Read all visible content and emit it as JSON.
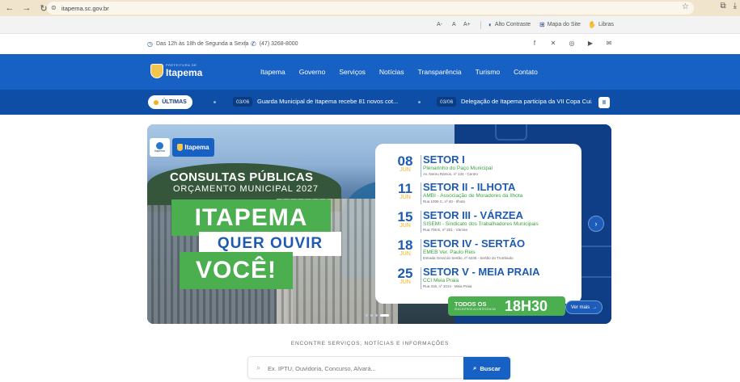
{
  "browser": {
    "url": "itapema.sc.gov.br"
  },
  "access_bar": {
    "font_decrease": "A-",
    "font_reset": "A",
    "font_increase": "A+",
    "high_contrast": "Alto Contraste",
    "site_map": "Mapa do Site",
    "libras": "Libras"
  },
  "info_bar": {
    "hours": "Das 12h às 18h de Segunda a Sexta",
    "phone": "(47) 3268-8000"
  },
  "header": {
    "logo_pre": "PREFEITURA DE",
    "logo_name": "Itapema",
    "menu": [
      "Itapema",
      "Governo",
      "Serviços",
      "Notícias",
      "Transparência",
      "Turismo",
      "Contato"
    ]
  },
  "ticker": {
    "badge": "ÚLTIMAS",
    "items": [
      {
        "date": "03/06",
        "headline": "Guarda Municipal de Itapema recebe 81 novos cot..."
      },
      {
        "date": "03/06",
        "headline": "Delegação de Itapema participa da VII Copa Cui..."
      }
    ],
    "pause": "II"
  },
  "banner": {
    "logo_small_caption": "Itapema",
    "logo_name": "Itapema",
    "consultas": "CONSULTAS PÚBLICAS",
    "orcamento": "ORÇAMENTO MUNICIPAL 2027",
    "headline1": "ITAPEMA",
    "headline2": "QUER OUVIR",
    "headline3": "VOCÊ!",
    "schedule": [
      {
        "day": "08",
        "month": "JUN",
        "sector": "SETOR I",
        "place": "Plenarinho do Paço Municipal",
        "addr": "Av. Nereu Ramos, nº 134 - Centro"
      },
      {
        "day": "11",
        "month": "JUN",
        "sector": "SETOR II - ILHOTA",
        "place": "AMBI - Associação de Moradores da Ilhota",
        "addr": "Rua 1006 C, nº 40 - Ilhota"
      },
      {
        "day": "15",
        "month": "JUN",
        "sector": "SETOR III - VÁRZEA",
        "place": "SISEMI - Sindicato dos Trabalhadores Municipais",
        "addr": "Rua 706 E, nº 201 - Várzea"
      },
      {
        "day": "18",
        "month": "JUN",
        "sector": "SETOR IV - SERTÃO",
        "place": "EMEB Ver. Paulo Reis",
        "addr": "Estrada Geral do Sertão, nº 6236 - Sertão do Trombudo"
      },
      {
        "day": "25",
        "month": "JUN",
        "sector": "SETOR V - MEIA PRAIA",
        "place": "CCI Meia Praia",
        "addr": "Rua 316, nº 1014 - Meia Praia"
      }
    ],
    "todos": "TODOS OS",
    "todos_sub": "ENCONTROS ACONTECEM ÀS",
    "hora": "18H30",
    "ver_mais": "Ver mais",
    "next": "›"
  },
  "search": {
    "label": "ENCONTRE SERVIÇOS, NOTÍCIAS E INFORMAÇÕES",
    "placeholder": "Ex. IPTU, Ouvidoria, Concurso, Alvará...",
    "button": "Buscar"
  },
  "colors": {
    "primary": "#1760c4",
    "ticker": "#0e4ea6",
    "accent_green": "#4bae4f",
    "accent_yellow": "#f2b21b"
  },
  "icons": [
    "back-icon",
    "forward-icon",
    "reload-icon",
    "site-info-icon",
    "star-icon",
    "extensions-icon",
    "download-icon",
    "contrast-icon",
    "sitemap-icon",
    "libras-icon",
    "clock-icon",
    "phone-icon",
    "facebook-icon",
    "x-icon",
    "instagram-icon",
    "youtube-icon",
    "email-icon",
    "pause-icon",
    "chevron-right-icon",
    "arrow-right-icon",
    "search-icon"
  ]
}
